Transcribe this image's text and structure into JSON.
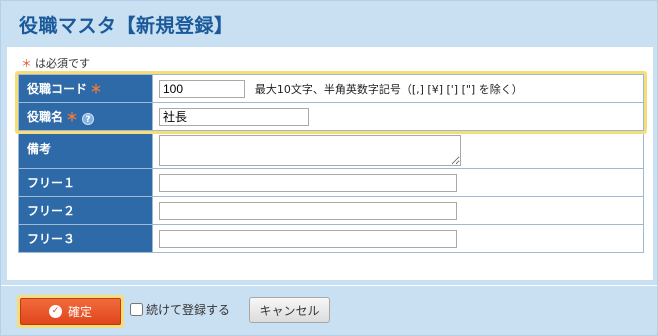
{
  "page": {
    "title": "役職マスタ【新規登録】",
    "required_note": "は必須です",
    "required_mark": "＊"
  },
  "form": {
    "code": {
      "label": "役職コード",
      "value": "100",
      "hint": "最大10文字、半角英数字記号（[,] [¥] ['] [\"] を除く）"
    },
    "name": {
      "label": "役職名",
      "value": "社長",
      "help_icon": "question-icon"
    },
    "remarks": {
      "label": "備考",
      "value": ""
    },
    "free1": {
      "label": "フリー１",
      "value": ""
    },
    "free2": {
      "label": "フリー２",
      "value": ""
    },
    "free3": {
      "label": "フリー３",
      "value": ""
    }
  },
  "actions": {
    "confirm_label": "確定",
    "confirm_icon": "check-circle-icon",
    "continue_label": "続けて登録する",
    "continue_checked": false,
    "cancel_label": "キャンセル"
  },
  "colors": {
    "panel_bg": "#c9dff2",
    "title": "#1a5a9a",
    "label_bg": "#2f6aa8",
    "required": "#e8542a",
    "confirm_button": "#e0461c",
    "highlight": "#f5dd7a"
  }
}
